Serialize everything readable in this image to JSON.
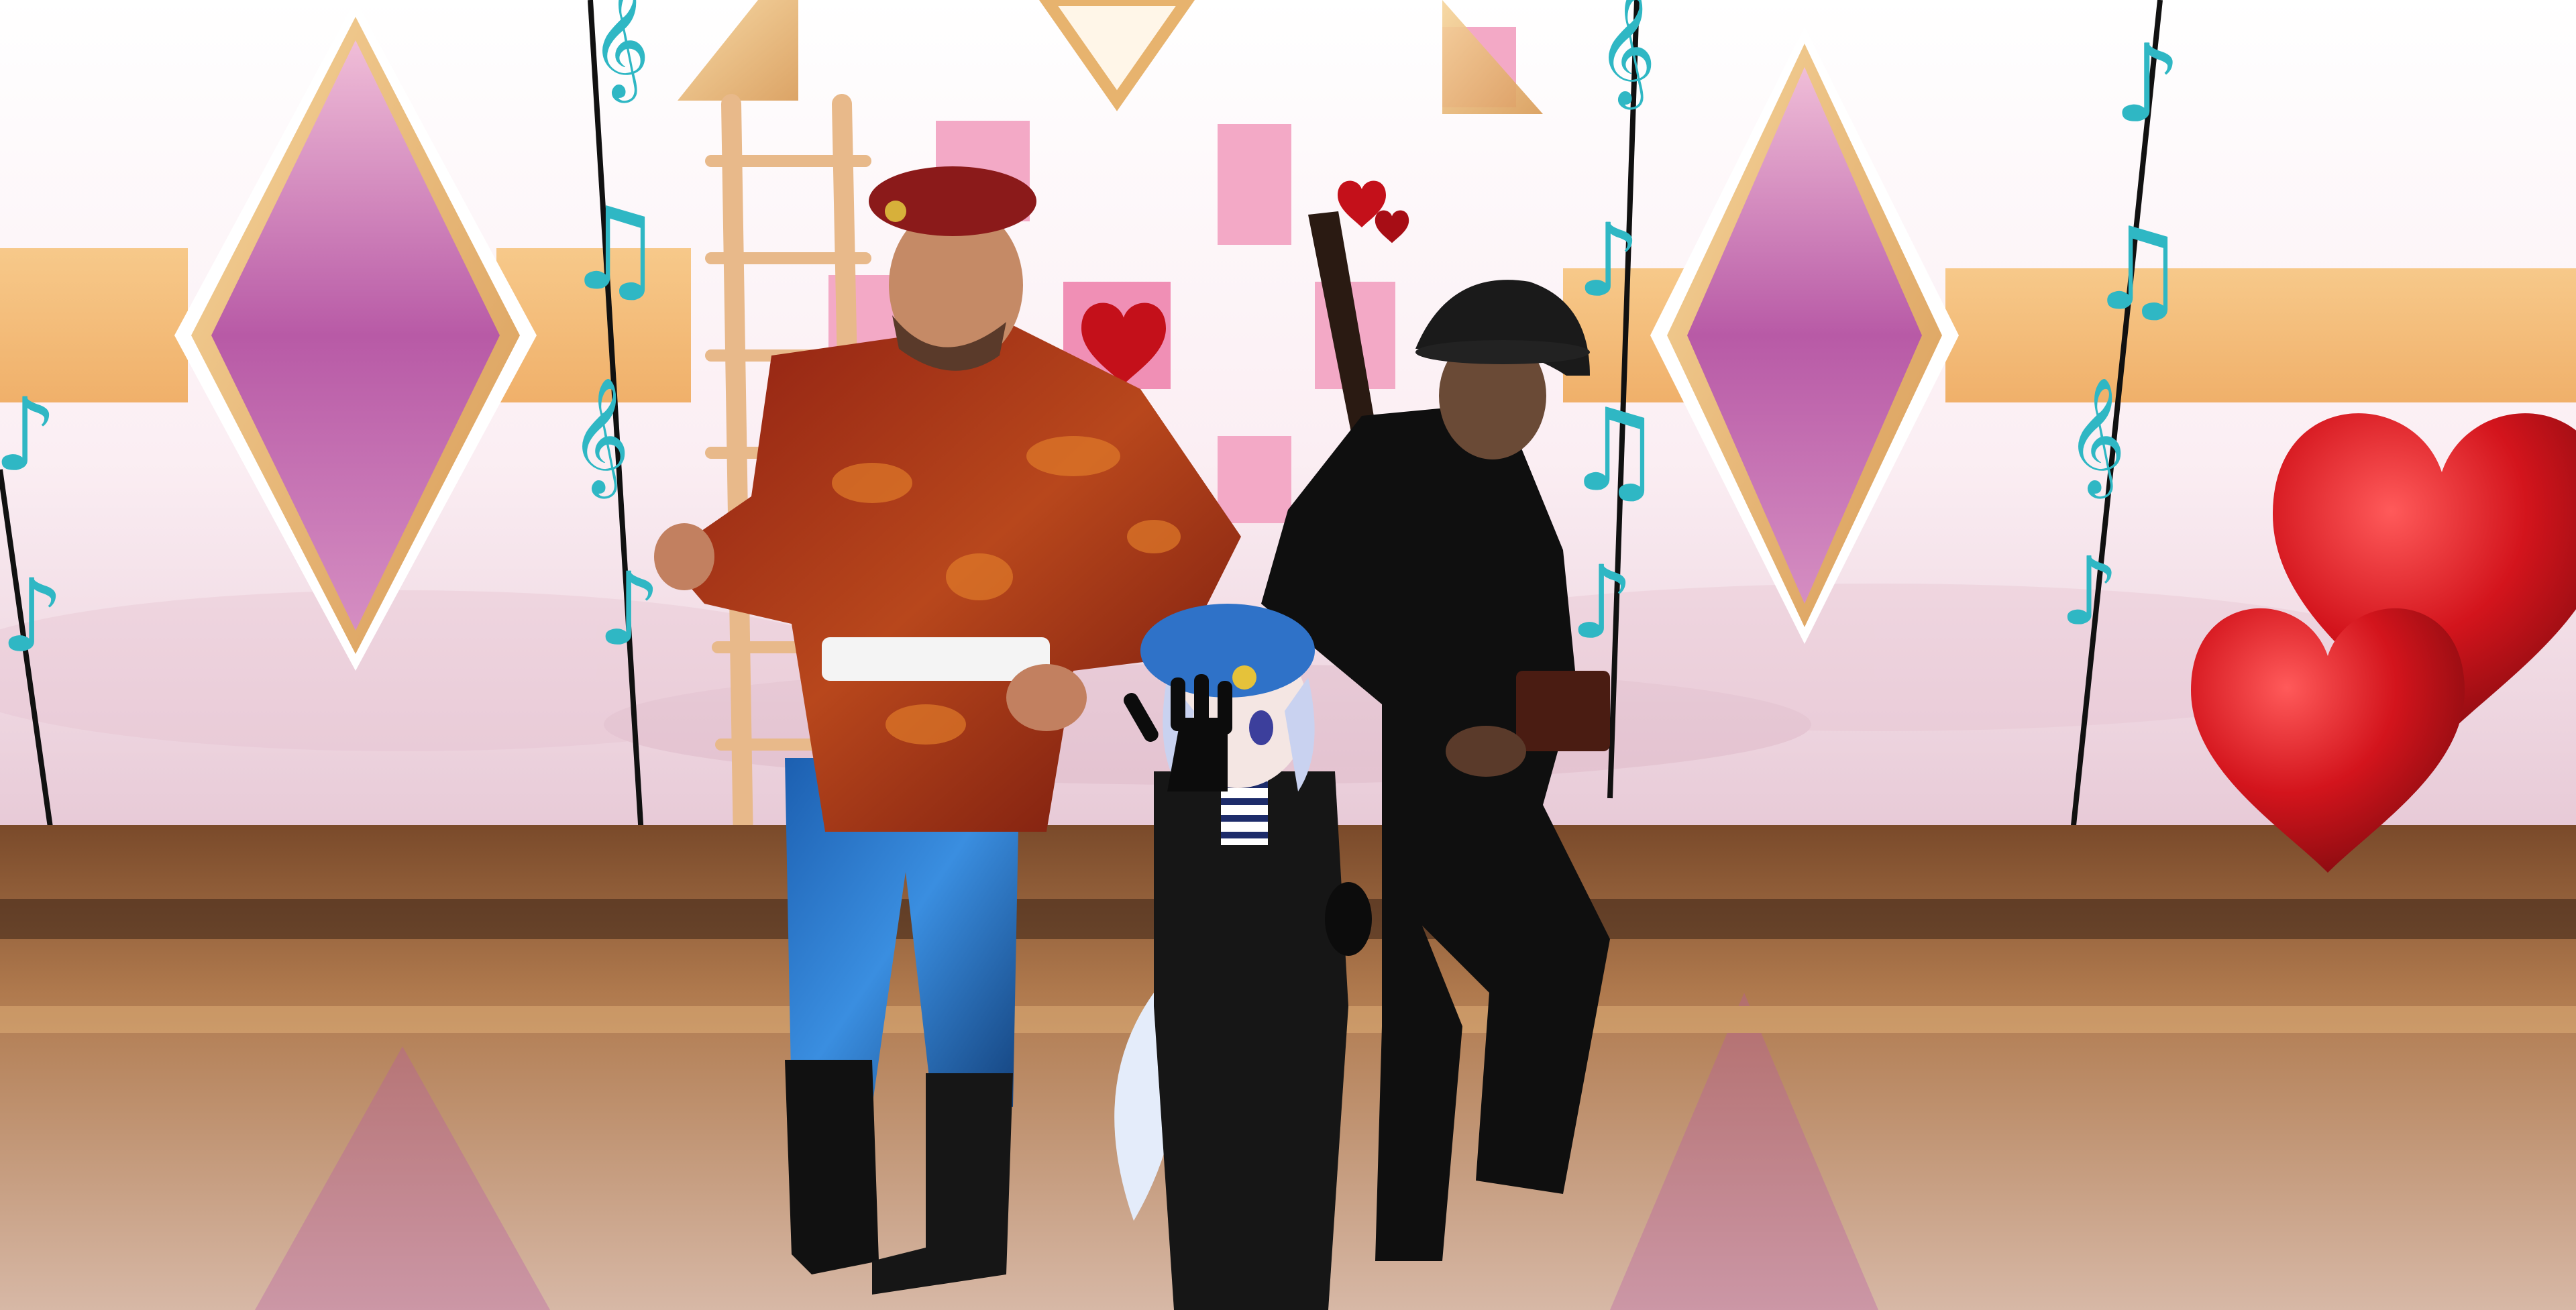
{
  "scene": {
    "type": "vr-world-screenshot",
    "setting": "pink valentine dance room with diamond windows, ladder, hearts and floating music notes",
    "colors": {
      "wall_glow": "#fdf2f6",
      "diamond_fill": "#b85aa6",
      "gold_frame": "#e9b06b",
      "floor": "#8a5a3a",
      "heart_red": "#d3141c",
      "note_teal": "#2fb7c4"
    }
  },
  "characters": [
    {
      "id": "red-beret-soldier",
      "outfit": "red camo jacket, maroon beret, blue camo pants, white belt"
    },
    {
      "id": "helmet-soldier",
      "outfit": "black uniform, steel helmet, rifle slung on back"
    },
    {
      "id": "blue-beret-avatar",
      "outfit": "blue beret, black jacket, striped shirt, white tail, waving"
    }
  ],
  "decorations": {
    "note_icons": [
      "eighth-note-icon",
      "beamed-notes-icon",
      "treble-clef-icon"
    ],
    "heart_icons": [
      "heart-icon"
    ]
  }
}
